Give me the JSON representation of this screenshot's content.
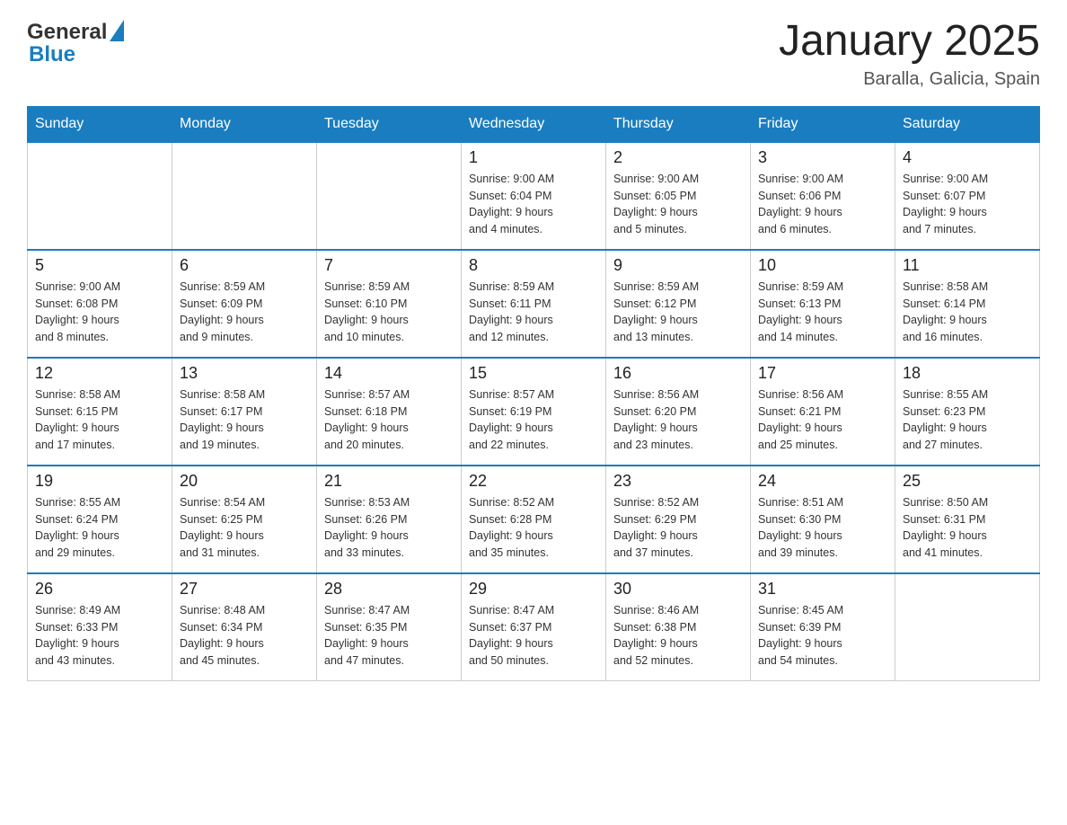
{
  "header": {
    "logo_general": "General",
    "logo_blue": "Blue",
    "title": "January 2025",
    "subtitle": "Baralla, Galicia, Spain"
  },
  "days_of_week": [
    "Sunday",
    "Monday",
    "Tuesday",
    "Wednesday",
    "Thursday",
    "Friday",
    "Saturday"
  ],
  "weeks": [
    {
      "days": [
        {
          "day": "",
          "info": ""
        },
        {
          "day": "",
          "info": ""
        },
        {
          "day": "",
          "info": ""
        },
        {
          "day": "1",
          "info": "Sunrise: 9:00 AM\nSunset: 6:04 PM\nDaylight: 9 hours\nand 4 minutes."
        },
        {
          "day": "2",
          "info": "Sunrise: 9:00 AM\nSunset: 6:05 PM\nDaylight: 9 hours\nand 5 minutes."
        },
        {
          "day": "3",
          "info": "Sunrise: 9:00 AM\nSunset: 6:06 PM\nDaylight: 9 hours\nand 6 minutes."
        },
        {
          "day": "4",
          "info": "Sunrise: 9:00 AM\nSunset: 6:07 PM\nDaylight: 9 hours\nand 7 minutes."
        }
      ]
    },
    {
      "days": [
        {
          "day": "5",
          "info": "Sunrise: 9:00 AM\nSunset: 6:08 PM\nDaylight: 9 hours\nand 8 minutes."
        },
        {
          "day": "6",
          "info": "Sunrise: 8:59 AM\nSunset: 6:09 PM\nDaylight: 9 hours\nand 9 minutes."
        },
        {
          "day": "7",
          "info": "Sunrise: 8:59 AM\nSunset: 6:10 PM\nDaylight: 9 hours\nand 10 minutes."
        },
        {
          "day": "8",
          "info": "Sunrise: 8:59 AM\nSunset: 6:11 PM\nDaylight: 9 hours\nand 12 minutes."
        },
        {
          "day": "9",
          "info": "Sunrise: 8:59 AM\nSunset: 6:12 PM\nDaylight: 9 hours\nand 13 minutes."
        },
        {
          "day": "10",
          "info": "Sunrise: 8:59 AM\nSunset: 6:13 PM\nDaylight: 9 hours\nand 14 minutes."
        },
        {
          "day": "11",
          "info": "Sunrise: 8:58 AM\nSunset: 6:14 PM\nDaylight: 9 hours\nand 16 minutes."
        }
      ]
    },
    {
      "days": [
        {
          "day": "12",
          "info": "Sunrise: 8:58 AM\nSunset: 6:15 PM\nDaylight: 9 hours\nand 17 minutes."
        },
        {
          "day": "13",
          "info": "Sunrise: 8:58 AM\nSunset: 6:17 PM\nDaylight: 9 hours\nand 19 minutes."
        },
        {
          "day": "14",
          "info": "Sunrise: 8:57 AM\nSunset: 6:18 PM\nDaylight: 9 hours\nand 20 minutes."
        },
        {
          "day": "15",
          "info": "Sunrise: 8:57 AM\nSunset: 6:19 PM\nDaylight: 9 hours\nand 22 minutes."
        },
        {
          "day": "16",
          "info": "Sunrise: 8:56 AM\nSunset: 6:20 PM\nDaylight: 9 hours\nand 23 minutes."
        },
        {
          "day": "17",
          "info": "Sunrise: 8:56 AM\nSunset: 6:21 PM\nDaylight: 9 hours\nand 25 minutes."
        },
        {
          "day": "18",
          "info": "Sunrise: 8:55 AM\nSunset: 6:23 PM\nDaylight: 9 hours\nand 27 minutes."
        }
      ]
    },
    {
      "days": [
        {
          "day": "19",
          "info": "Sunrise: 8:55 AM\nSunset: 6:24 PM\nDaylight: 9 hours\nand 29 minutes."
        },
        {
          "day": "20",
          "info": "Sunrise: 8:54 AM\nSunset: 6:25 PM\nDaylight: 9 hours\nand 31 minutes."
        },
        {
          "day": "21",
          "info": "Sunrise: 8:53 AM\nSunset: 6:26 PM\nDaylight: 9 hours\nand 33 minutes."
        },
        {
          "day": "22",
          "info": "Sunrise: 8:52 AM\nSunset: 6:28 PM\nDaylight: 9 hours\nand 35 minutes."
        },
        {
          "day": "23",
          "info": "Sunrise: 8:52 AM\nSunset: 6:29 PM\nDaylight: 9 hours\nand 37 minutes."
        },
        {
          "day": "24",
          "info": "Sunrise: 8:51 AM\nSunset: 6:30 PM\nDaylight: 9 hours\nand 39 minutes."
        },
        {
          "day": "25",
          "info": "Sunrise: 8:50 AM\nSunset: 6:31 PM\nDaylight: 9 hours\nand 41 minutes."
        }
      ]
    },
    {
      "days": [
        {
          "day": "26",
          "info": "Sunrise: 8:49 AM\nSunset: 6:33 PM\nDaylight: 9 hours\nand 43 minutes."
        },
        {
          "day": "27",
          "info": "Sunrise: 8:48 AM\nSunset: 6:34 PM\nDaylight: 9 hours\nand 45 minutes."
        },
        {
          "day": "28",
          "info": "Sunrise: 8:47 AM\nSunset: 6:35 PM\nDaylight: 9 hours\nand 47 minutes."
        },
        {
          "day": "29",
          "info": "Sunrise: 8:47 AM\nSunset: 6:37 PM\nDaylight: 9 hours\nand 50 minutes."
        },
        {
          "day": "30",
          "info": "Sunrise: 8:46 AM\nSunset: 6:38 PM\nDaylight: 9 hours\nand 52 minutes."
        },
        {
          "day": "31",
          "info": "Sunrise: 8:45 AM\nSunset: 6:39 PM\nDaylight: 9 hours\nand 54 minutes."
        },
        {
          "day": "",
          "info": ""
        }
      ]
    }
  ]
}
